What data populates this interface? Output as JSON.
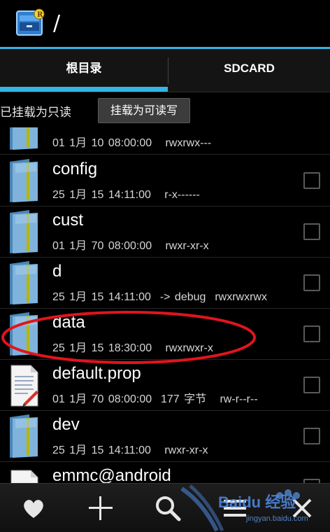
{
  "titlebar": {
    "path": "/"
  },
  "tabs": [
    {
      "label": "根目录"
    },
    {
      "label": "SDCARD"
    }
  ],
  "status": {
    "text": "已挂载为只读",
    "button_label": "挂载为可读写"
  },
  "files": [
    {
      "name": "",
      "meta": "01 1月 10 08:00:00   rwxrwx---",
      "icon": "folder-icon"
    },
    {
      "name": "config",
      "meta": "25 1月 15 14:11:00   r-x------",
      "icon": "folder-icon"
    },
    {
      "name": "cust",
      "meta": "01 1月 70 08:00:00   rwxr-xr-x",
      "icon": "folder-icon"
    },
    {
      "name": "d",
      "meta": "25 1月 15 14:11:00  -> debug  rwxrwxrwx",
      "icon": "folder-icon"
    },
    {
      "name": "data",
      "meta": "25 1月 15 18:30:00   rwxrwxr-x",
      "icon": "folder-icon"
    },
    {
      "name": "default.prop",
      "meta": "01 1月 70 08:00:00  177 字节   rw-r--r--",
      "icon": "text-file-icon"
    },
    {
      "name": "dev",
      "meta": "25 1月 15 14:11:00   rwxr-xr-x",
      "icon": "folder-icon"
    },
    {
      "name": "emmc@android",
      "meta": "",
      "icon": "file-icon"
    }
  ],
  "bottom_bar": {
    "icons": [
      "heart-icon",
      "plus-icon",
      "search-icon",
      "menu-icon",
      "close-icon"
    ]
  },
  "watermark": {
    "brand": "Baidu 经验",
    "url": "jingyan.baidu.com"
  },
  "colors": {
    "accent": "#33b5e5",
    "highlight": "#e0141e",
    "background": "#000000"
  }
}
